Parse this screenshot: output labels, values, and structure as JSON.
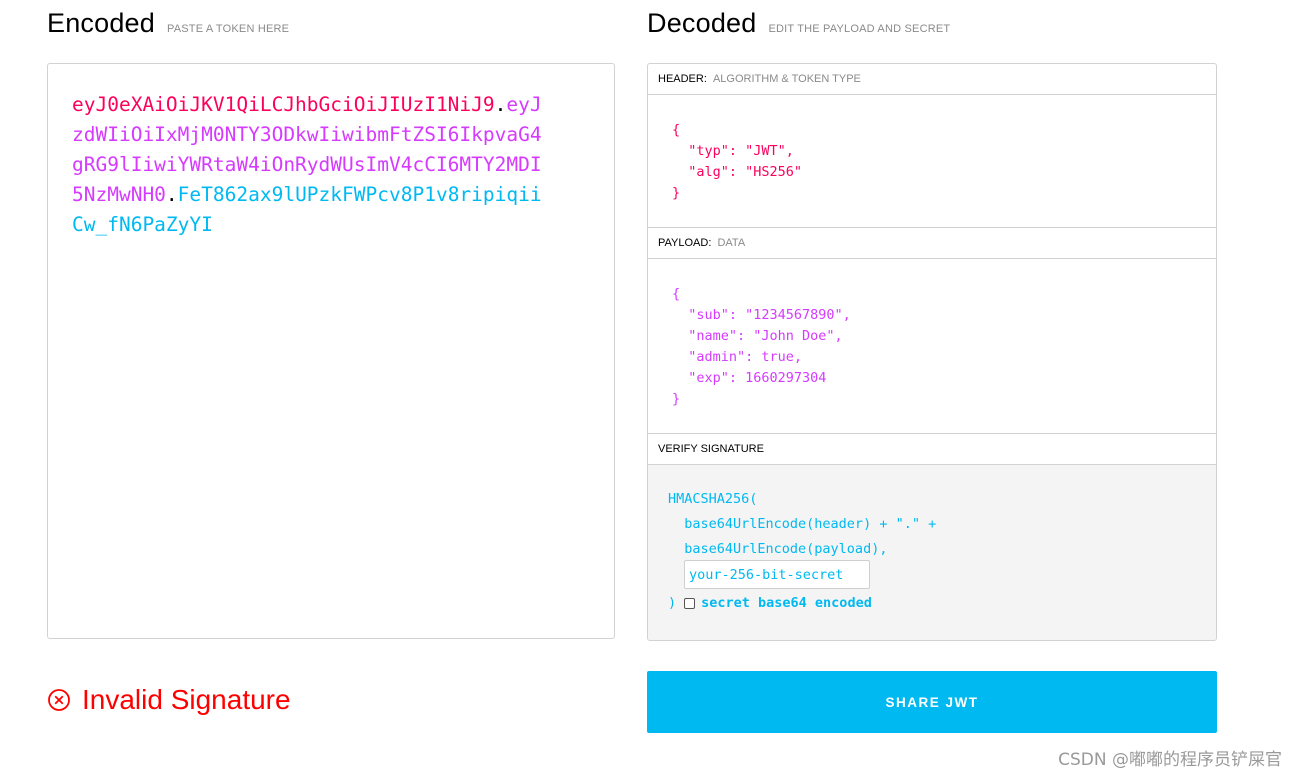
{
  "encoded": {
    "title": "Encoded",
    "subtitle": "PASTE A TOKEN HERE",
    "token": {
      "header": "eyJ0eXAiOiJKV1QiLCJhbGciOiJIUzI1NiJ9",
      "payload": "eyJzdWIiOiIxMjM0NTY3ODkwIiwibmFtZSI6IkpvaG4gRG9lIiwiYWRtaW4iOnRydWUsImV4cCI6MTY2MDI5NzMwNH0",
      "signature": "FeT862ax9lUPzkFWPcv8P1v8ripiqiiCw_fN6PaZyYI",
      "separator": "."
    }
  },
  "decoded": {
    "title": "Decoded",
    "subtitle": "EDIT THE PAYLOAD AND SECRET",
    "header_panel": {
      "label": "HEADER:",
      "sublabel": "ALGORITHM & TOKEN TYPE",
      "json": "{\n  \"typ\": \"JWT\",\n  \"alg\": \"HS256\"\n}"
    },
    "payload_panel": {
      "label": "PAYLOAD:",
      "sublabel": "DATA",
      "json": "{\n  \"sub\": \"1234567890\",\n  \"name\": \"John Doe\",\n  \"admin\": true,\n  \"exp\": 1660297304\n}"
    },
    "signature_panel": {
      "label": "VERIFY SIGNATURE",
      "line1": "HMACSHA256(",
      "line2": "  base64UrlEncode(header) + \".\" +",
      "line3": "  base64UrlEncode(payload),",
      "secret_placeholder": "your-256-bit-secret",
      "close_paren": ")",
      "checkbox_label": "secret base64 encoded",
      "checkbox_checked": false
    }
  },
  "status": {
    "text": "Invalid Signature",
    "icon": "x-circle-icon",
    "color": "#ff0000"
  },
  "share_button": {
    "label": "SHARE JWT",
    "color": "#00b9f1"
  },
  "watermark": "CSDN @嘟嘟的程序员铲屎官",
  "colors": {
    "header": "#fb015b",
    "payload": "#d63aff",
    "signature": "#00b9f1"
  }
}
